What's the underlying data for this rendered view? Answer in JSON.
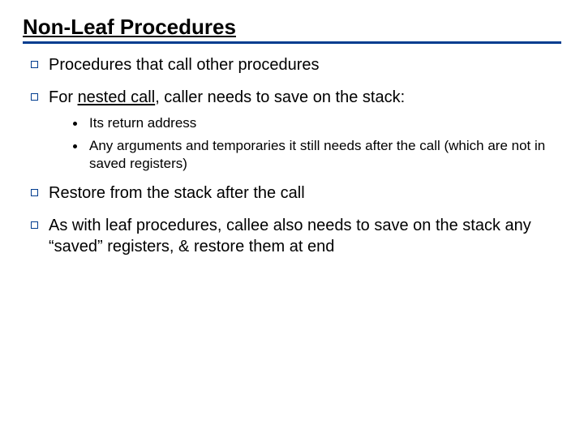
{
  "title": "Non-Leaf Procedures",
  "bullets": {
    "b1": "Procedures that call other procedures",
    "b2_pre": "For ",
    "b2_u": "nested call",
    "b2_post": ", caller needs to save on the stack:",
    "b2_sub1": "Its return address",
    "b2_sub2": "Any arguments and temporaries it still needs after the call (which are not in saved registers)",
    "b3": "Restore from the stack after the call",
    "b4": "As with leaf procedures, callee also needs to save on the stack any “saved” registers, & restore them at end"
  }
}
